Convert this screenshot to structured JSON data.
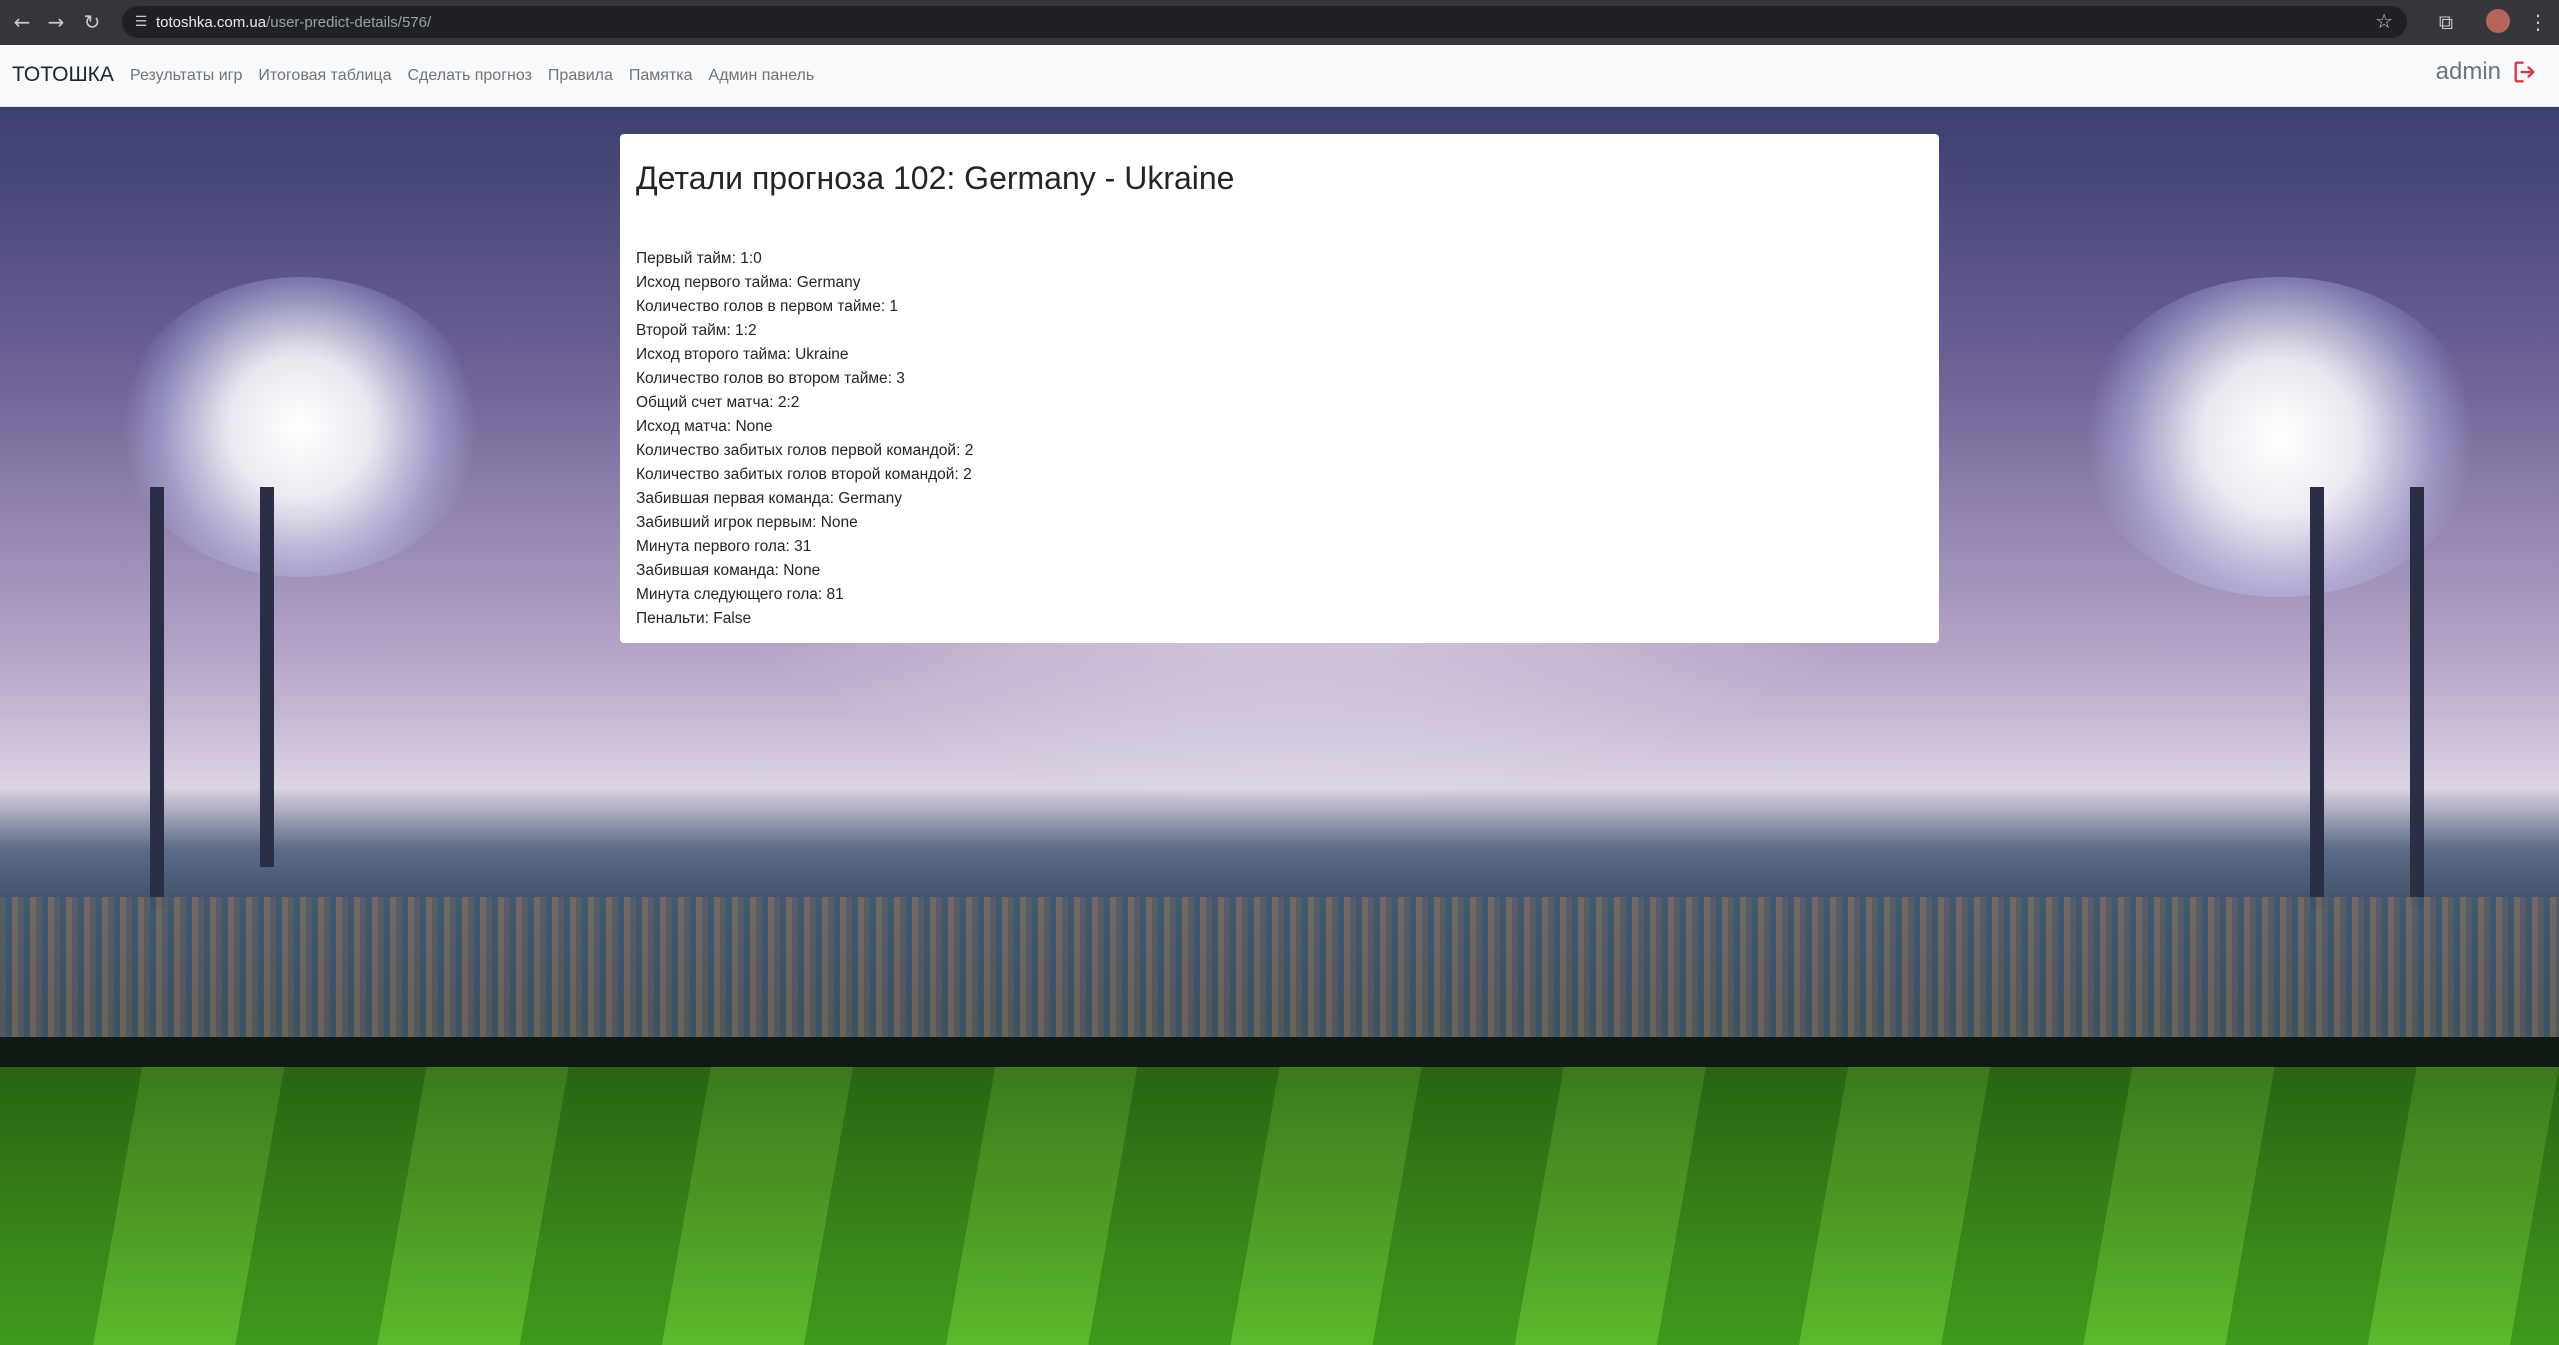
{
  "browser": {
    "url_host": "totoshka.com.ua",
    "url_path": "/user-predict-details/576/",
    "icons": {
      "back": "arrow-left-icon",
      "forward": "arrow-right-icon",
      "reload": "reload-icon",
      "site_info": "tune-icon",
      "bookmark": "star-icon",
      "extensions": "puzzle-icon",
      "profile": "avatar"
    }
  },
  "navbar": {
    "brand": "ТОТОШКА",
    "links": [
      "Результаты игр",
      "Итоговая таблица",
      "Сделать прогноз",
      "Правила",
      "Памятка",
      "Админ панель"
    ],
    "username": "admin",
    "logout_icon": "logout-icon",
    "logout_color": "#dc3545"
  },
  "card": {
    "title": "Детали прогноза 102: Germany - Ukraine",
    "details": [
      "Первый тайм: 1:0",
      "Исход первого тайма: Germany",
      "Количество голов в первом тайме: 1",
      "Второй тайм: 1:2",
      "Исход второго тайма: Ukraine",
      "Количество голов во втором тайме: 3",
      "Общий счет матча: 2:2",
      "Исход матча: None",
      "Количество забитых голов первой командой: 2",
      "Количество забитых голов второй командой: 2",
      "Забившая первая команда: Germany",
      "Забивший игрок первым: None",
      "Минута первого гола: 31",
      "Забившая команда: None",
      "Минута следующего гола: 81",
      "Пенальти: False"
    ]
  }
}
